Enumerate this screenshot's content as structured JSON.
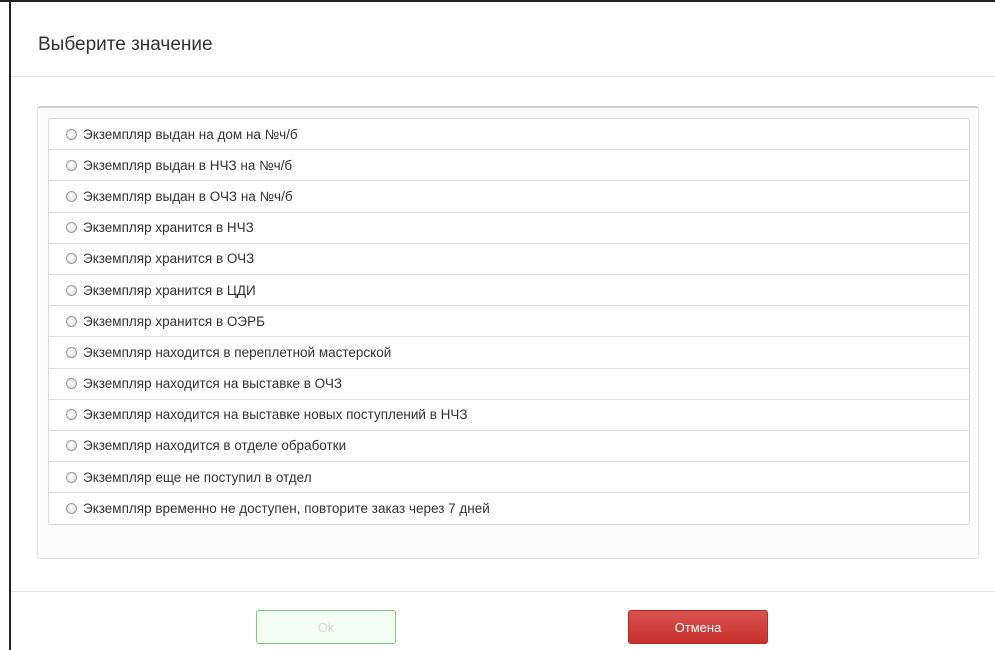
{
  "dialog": {
    "title": "Выберите значение"
  },
  "options": [
    {
      "label": "Экземпляр выдан на дом на №ч/б"
    },
    {
      "label": "Экземпляр выдан в НЧЗ на №ч/б"
    },
    {
      "label": "Экземпляр выдан в ОЧЗ на №ч/б"
    },
    {
      "label": "Экземпляр хранится в НЧЗ"
    },
    {
      "label": "Экземпляр хранится в ОЧЗ"
    },
    {
      "label": "Экземпляр хранится в ЦДИ"
    },
    {
      "label": "Экземпляр хранится в ОЭРБ"
    },
    {
      "label": "Экземпляр находится в переплетной мастерской"
    },
    {
      "label": "Экземпляр находится на выставке в ОЧЗ"
    },
    {
      "label": "Экземпляр находится на выставке новых поступлений в НЧЗ"
    },
    {
      "label": "Экземпляр находится в отделе обработки"
    },
    {
      "label": "Экземпляр еще не поступил в отдел"
    },
    {
      "label": "Экземпляр временно не доступен, повторите заказ через 7 дней"
    }
  ],
  "footer": {
    "ok_label": "Ok",
    "cancel_label": "Отмена"
  },
  "colors": {
    "cancel_button": "#d9534f",
    "ok_button_border": "#7fc97f"
  }
}
